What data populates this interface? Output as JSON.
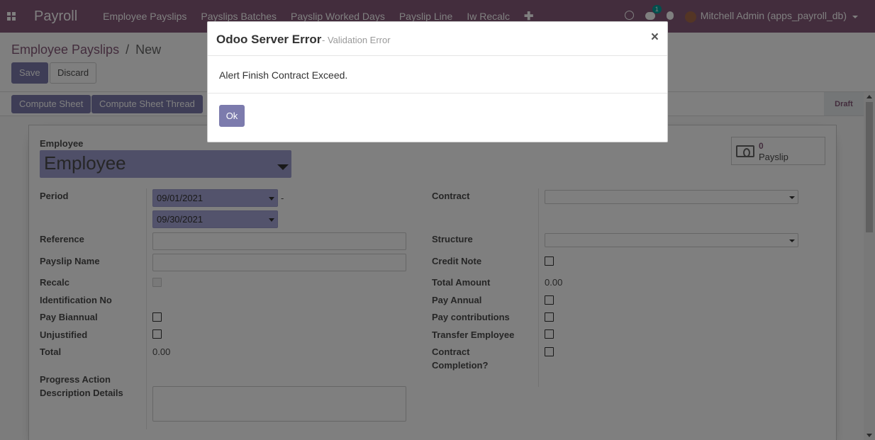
{
  "navbar": {
    "app_name": "Payroll",
    "menu": [
      "Employee Payslips",
      "Payslips Batches",
      "Payslip Worked Days",
      "Payslip Line",
      "Iw Recalc"
    ],
    "chat_badge": "1",
    "user": "Mitchell Admin (apps_payroll_db)"
  },
  "control_panel": {
    "breadcrumb_parent": "Employee Payslips",
    "breadcrumb_sep": "/",
    "breadcrumb_current": "New",
    "save_label": "Save",
    "discard_label": "Discard"
  },
  "statusbar": {
    "compute_sheet": "Compute Sheet",
    "compute_sheet_thread": "Compute Sheet Thread",
    "status": "Draft"
  },
  "smart_button": {
    "value": "0",
    "label": "Payslip"
  },
  "form": {
    "employee_label": "Employee",
    "employee_placeholder": "Employee",
    "period_label": "Period",
    "date_from": "09/01/2021",
    "date_to": "09/30/2021",
    "period_dash": "-",
    "reference_label": "Reference",
    "payslip_name_label": "Payslip Name",
    "recalc_label": "Recalc",
    "identification_label": "Identification No",
    "pay_biannual_label": "Pay Biannual",
    "unjustified_label": "Unjustified",
    "total_label": "Total",
    "total_value": "0.00",
    "progress_action_label": "Progress Action",
    "description_details_label": "Description Details",
    "contract_label": "Contract",
    "structure_label": "Structure",
    "credit_note_label": "Credit Note",
    "total_amount_label": "Total Amount",
    "total_amount_value": "0.00",
    "pay_annual_label": "Pay Annual",
    "pay_contributions_label": "Pay contributions",
    "transfer_employee_label": "Transfer Employee",
    "contract_completion_line1": "Contract",
    "contract_completion_line2": "Completion?"
  },
  "modal": {
    "title": "Odoo Server Error",
    "subtitle": "- Validation Error",
    "close": "×",
    "message": "Alert Finish Contract Exceed.",
    "ok_label": "Ok"
  },
  "colors": {
    "brand": "#875a7b",
    "primary_button": "#7c7bad",
    "required_field": "#a7a7d8"
  }
}
